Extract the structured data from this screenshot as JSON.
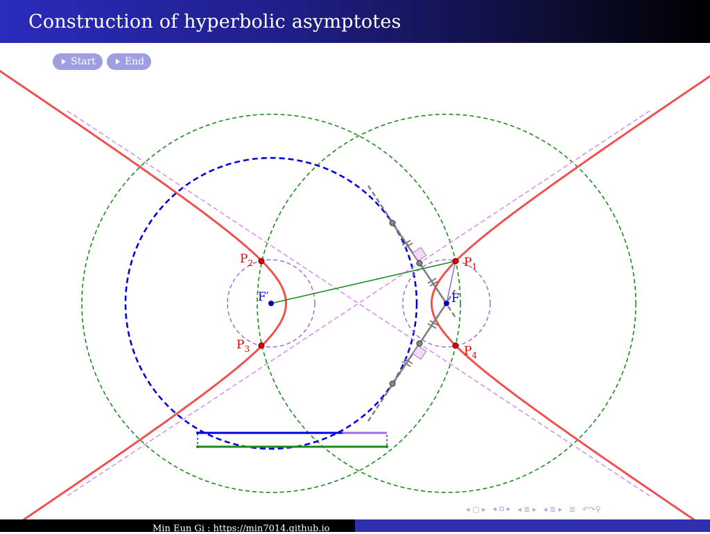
{
  "slide": {
    "title": "Construction of hyperbolic asymptotes"
  },
  "controls": {
    "start_label": "Start",
    "end_label": "End"
  },
  "colors": {
    "hyperbola": "#f05050",
    "asymptote": "#d890f0",
    "director_circle": "#0000dd",
    "green_circle": "#1a8a1a",
    "small_circle": "#9a70e0",
    "construction": "#808080",
    "focus_point": "#0000cc",
    "intersection_point": "#dd0000"
  },
  "points": {
    "p1": {
      "name": "P",
      "sub": "1"
    },
    "p2": {
      "name": "P",
      "sub": "2"
    },
    "p3": {
      "name": "P",
      "sub": "3"
    },
    "p4": {
      "name": "P",
      "sub": "4"
    },
    "focus": "F",
    "focus_prime": "F′"
  },
  "beamer_nav": {
    "icons": [
      "nav-frame-icon",
      "nav-subsection-icon",
      "nav-section-icon",
      "nav-doc-icon",
      "nav-search-icon"
    ]
  },
  "footer": {
    "author": "Min Eun Gi : https://min7014.github.io"
  }
}
